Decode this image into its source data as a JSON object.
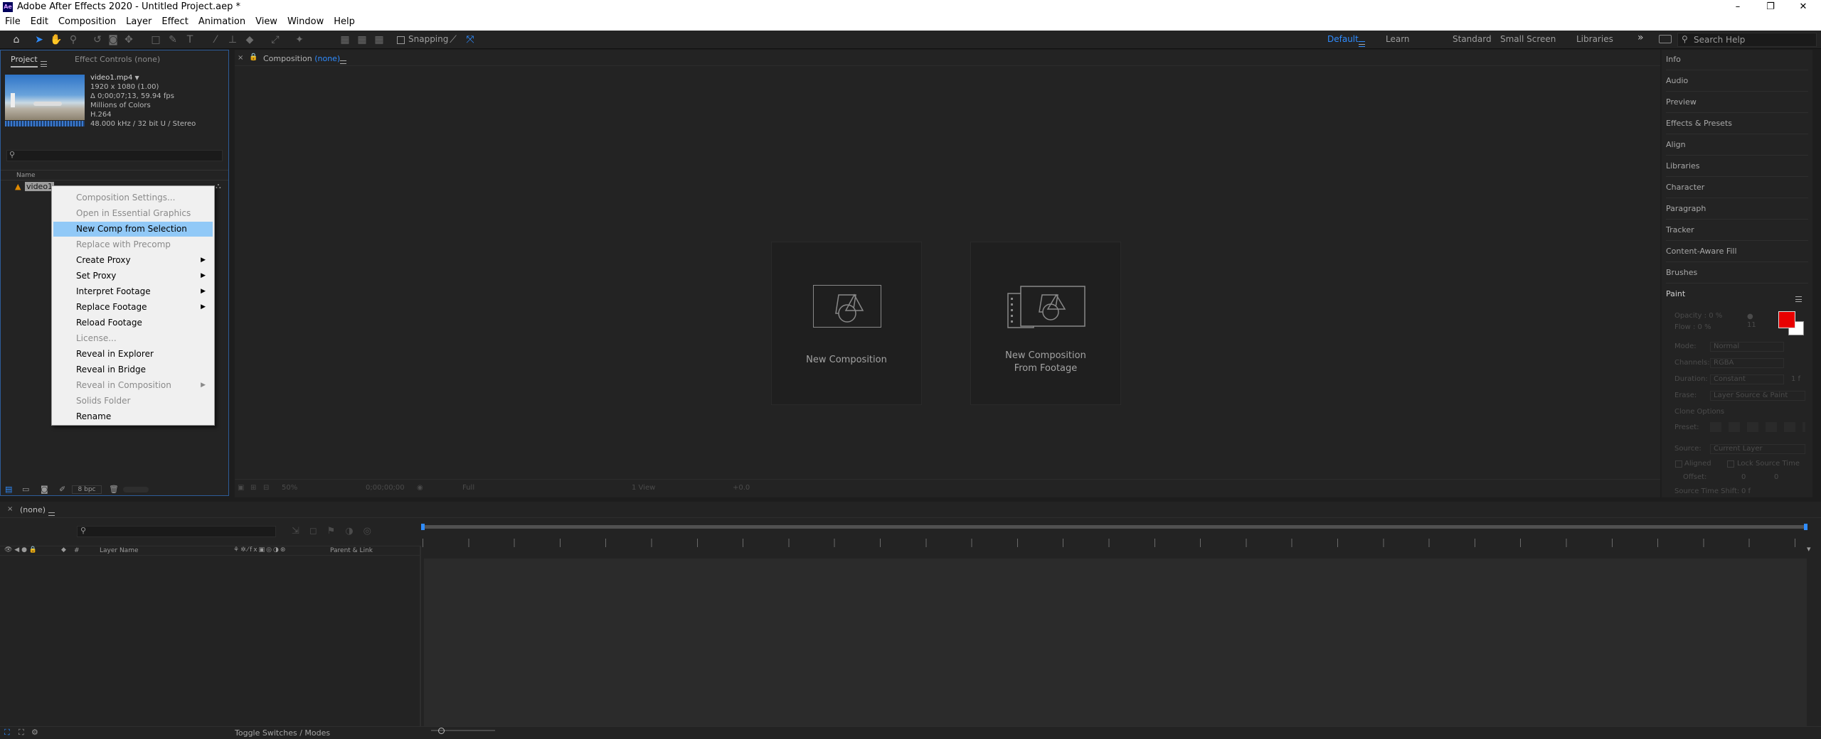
{
  "window": {
    "title": "Adobe After Effects 2020 - Untitled Project.aep *",
    "minimize": "–",
    "maximize": "❐",
    "close": "✕"
  },
  "menubar": [
    "File",
    "Edit",
    "Composition",
    "Layer",
    "Effect",
    "Animation",
    "View",
    "Window",
    "Help"
  ],
  "toolbar": {
    "snapping_label": "Snapping",
    "workspaces": [
      "Default",
      "Learn",
      "Standard",
      "Small Screen",
      "Libraries"
    ],
    "active_workspace": "Default",
    "overflow": "»",
    "search_placeholder": "Search Help"
  },
  "project_panel": {
    "tab_project": "Project",
    "tab_effect_controls": "Effect Controls (none)",
    "footage": {
      "name": "video1.mp4",
      "resolution": "1920 x 1080 (1.00)",
      "duration": "Δ 0;00;07;13, 59.94 fps",
      "colors": "Millions of Colors",
      "codec": "H.264",
      "audio": "48.000 kHz / 32 bit U / Stereo"
    },
    "column_name": "Name",
    "item_label": "video1",
    "bpc": "8 bpc"
  },
  "context_menu": {
    "items": [
      {
        "label": "Composition Settings...",
        "disabled": true,
        "submenu": false
      },
      {
        "label": "Open in Essential Graphics",
        "disabled": true,
        "submenu": false
      },
      {
        "label": "New Comp from Selection",
        "disabled": false,
        "submenu": false,
        "highlighted": true
      },
      {
        "label": "Replace with Precomp",
        "disabled": true,
        "submenu": false
      },
      {
        "label": "Create Proxy",
        "disabled": false,
        "submenu": true
      },
      {
        "label": "Set Proxy",
        "disabled": false,
        "submenu": true
      },
      {
        "label": "Interpret Footage",
        "disabled": false,
        "submenu": true
      },
      {
        "label": "Replace Footage",
        "disabled": false,
        "submenu": true
      },
      {
        "label": "Reload Footage",
        "disabled": false,
        "submenu": false
      },
      {
        "label": "License...",
        "disabled": true,
        "submenu": false
      },
      {
        "label": "Reveal in Explorer",
        "disabled": false,
        "submenu": false
      },
      {
        "label": "Reveal in Bridge",
        "disabled": false,
        "submenu": false
      },
      {
        "label": "Reveal in Composition",
        "disabled": true,
        "submenu": true
      },
      {
        "label": "Solids Folder",
        "disabled": true,
        "submenu": false
      },
      {
        "label": "Rename",
        "disabled": false,
        "submenu": false
      }
    ]
  },
  "composition_panel": {
    "tab_prefix": "Composition",
    "tab_value": "(none)",
    "new_composition": "New Composition",
    "new_from_footage_line1": "New Composition",
    "new_from_footage_line2": "From Footage",
    "footer_zoom": "50%",
    "footer_time": "0;00;00;00",
    "footer_res": "Full",
    "footer_view": "1 View",
    "footer_exposure": "+0.0"
  },
  "right_panel": {
    "items": [
      "Info",
      "Audio",
      "Preview",
      "Effects & Presets",
      "Align",
      "Libraries",
      "Character",
      "Paragraph",
      "Tracker",
      "Content-Aware Fill",
      "Brushes"
    ],
    "paint": {
      "title": "Paint",
      "opacity": "Opacity : 0 %",
      "flow": "Flow : 0 %",
      "brush_size": "11",
      "mode_label": "Mode:",
      "mode_value": "Normal",
      "channels_label": "Channels:",
      "channels_value": "RGBA",
      "duration_label": "Duration:",
      "duration_value": "Constant",
      "duration_frames": "1 f",
      "erase_label": "Erase:",
      "erase_value": "Layer Source & Paint",
      "clone_options": "Clone Options",
      "preset_label": "Preset:",
      "source_label": "Source:",
      "source_value": "Current Layer",
      "aligned": "Aligned",
      "lock_source": "Lock Source Time",
      "offset_label": "Offset:",
      "offset_x": "0",
      "offset_y": "0",
      "source_time_shift": "Source Time Shift:",
      "source_time_shift_value": "0 f",
      "foreground_color": "#e80000",
      "background_color": "#ffffff"
    }
  },
  "timeline": {
    "tab_label": "(none)",
    "col_label": "#",
    "col_layer_name": "Layer Name",
    "col_parent": "Parent & Link",
    "toggle": "Toggle Switches / Modes"
  }
}
